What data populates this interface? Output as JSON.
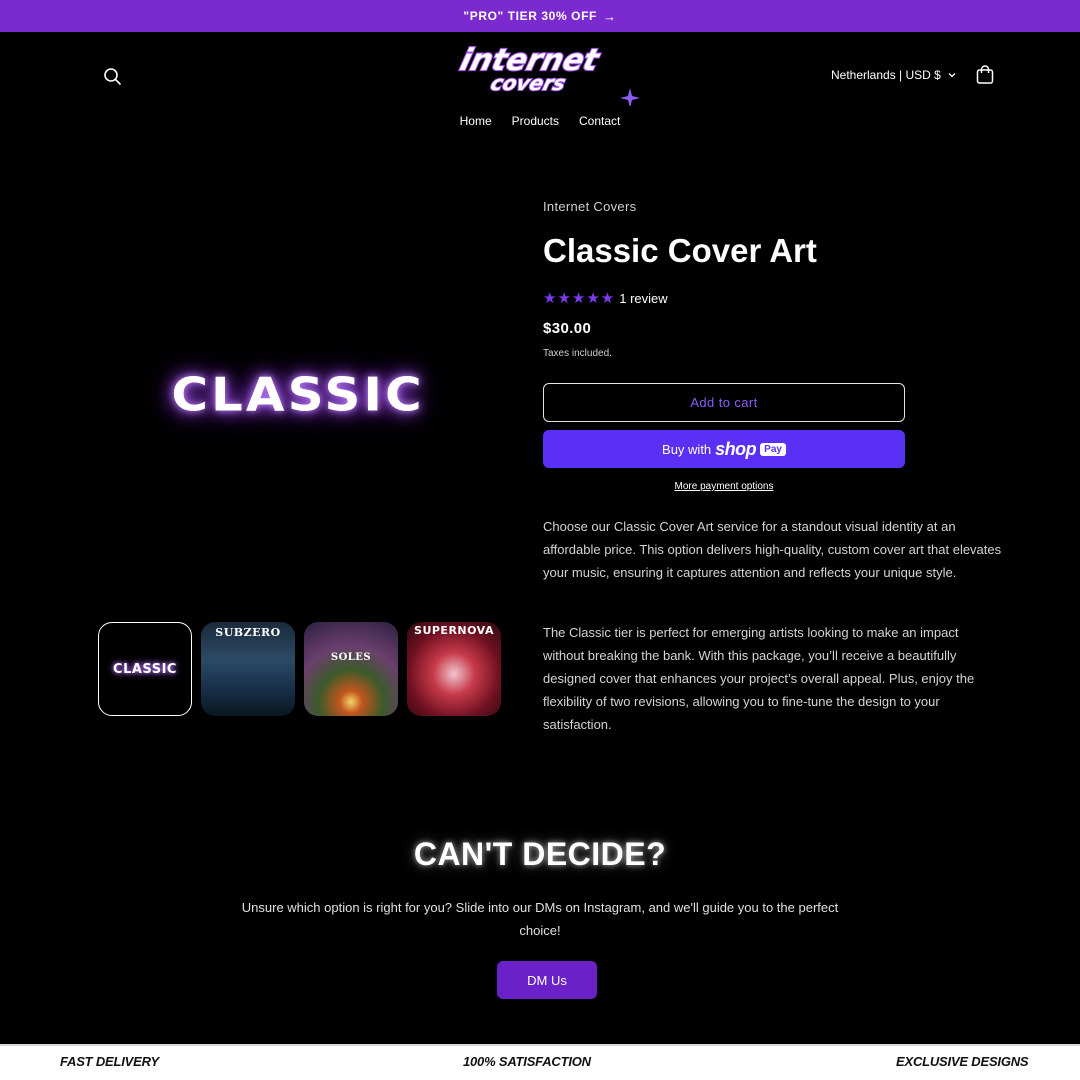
{
  "announcement": {
    "text": "\"PRO\" TIER 30% OFF",
    "arrow": "→"
  },
  "header": {
    "logo_line1": "internet",
    "logo_line2": "covers",
    "locale": "Netherlands | USD $",
    "nav": [
      "Home",
      "Products",
      "Contact"
    ]
  },
  "gallery": {
    "main_text": "CLASSIC",
    "thumbnails": [
      "CLASSIC",
      "SUBZERO",
      "SOLES",
      "SUPERNOVA"
    ]
  },
  "product": {
    "vendor": "Internet Covers",
    "title": "Classic Cover Art",
    "stars": "★★★★★",
    "rating": 5,
    "review_text": "1 review",
    "price": "$30.00",
    "tax_note": "Taxes included.",
    "add_to_cart": "Add to cart",
    "buy_with": "Buy with",
    "shop_word": "shop",
    "pay_badge": "Pay",
    "more_payment": "More payment options",
    "description_1": "Choose our Classic Cover Art service for a standout visual identity at an affordable price. This option delivers high-quality, custom cover art that elevates your music, ensuring it captures attention and reflects your unique style.",
    "description_2": "The Classic tier is perfect for emerging artists looking to make an impact without breaking the bank. With this package, you’ll receive a beautifully designed cover that enhances your project’s overall appeal. Plus, enjoy the flexibility of two revisions, allowing you to fine-tune the design to your satisfaction."
  },
  "cta": {
    "title": "CAN'T DECIDE?",
    "text": "Unsure which option is right for you? Slide into our DMs on Instagram, and we'll guide you to the perfect choice!",
    "button": "DM Us"
  },
  "ticker": [
    "FAST DELIVERY",
    "100% SATISFACTION",
    "EXCLUSIVE DESIGNS"
  ],
  "colors": {
    "accent": "#7b2ad0",
    "shop_pay": "#5a31f4",
    "star": "#7c3aed",
    "dm_button": "#6b21c8"
  }
}
